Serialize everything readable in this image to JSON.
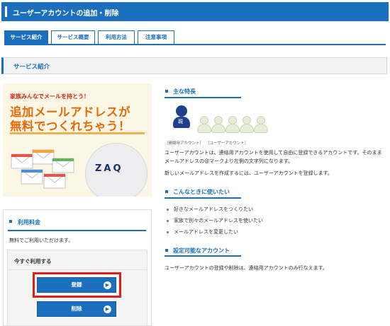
{
  "header": {
    "title": "ユーザーアカウントの追加・削除"
  },
  "tabs": [
    {
      "label": "サービス紹介",
      "active": true
    },
    {
      "label": "サービス概要",
      "active": false
    },
    {
      "label": "利用方法",
      "active": false
    },
    {
      "label": "注意事項",
      "active": false
    }
  ],
  "section": {
    "title": "サービス紹介"
  },
  "promo": {
    "tagline": "家族みんなでメールを持とう！",
    "headline_line1": "追加メールアドレスが",
    "headline_line2": "無料でつくれちゃう！",
    "mascot_text": "ZAQ"
  },
  "pricing": {
    "title": "利用料金",
    "description": "無料でご利用いただけます。",
    "use_now_label": "今すぐ利用する",
    "register_label": "登録",
    "delete_label": "削除"
  },
  "features": {
    "title": "主な特長",
    "parent_badge": "親",
    "caption_parent": "［連絡用アカウント］",
    "caption_user": "［ユーザーアカウント］",
    "para1": "ユーザーアカウントは、連絡用アカウントを使用して自由に登録できるアカウントです。そのまま",
    "para2": "メールアドレスの@マークより左側の文字列になります。",
    "para3": "新しいメールアドレスを作成するには、ユーザーアカウントを登録します。"
  },
  "use_cases": {
    "title": "こんなときに使いたい",
    "items": [
      "好きなメールアドレスをつくりたい",
      "家族で別々のメールアドレスを使いたい",
      "メールアドレスを変更したい"
    ]
  },
  "configurable": {
    "title": "設定可能なアカウント",
    "text": "ユーザーアカウントの登録や削除は、連絡用アカウントのみ行なえます。"
  },
  "colors": {
    "primary": "#1b6fbd",
    "accent_orange": "#e8690b",
    "highlight_red": "#e01e1e"
  }
}
